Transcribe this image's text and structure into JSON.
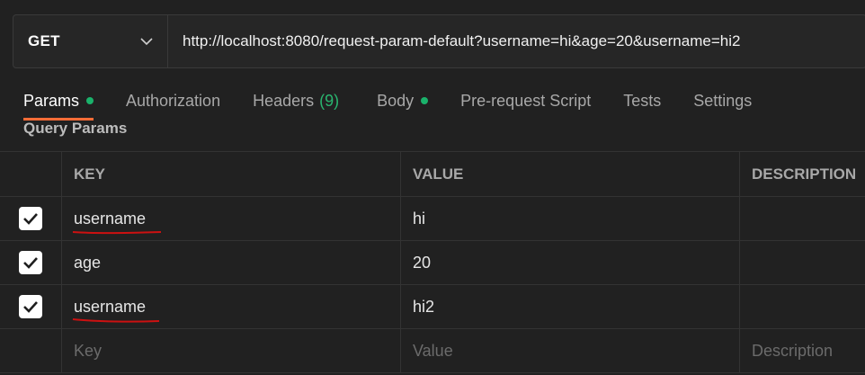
{
  "request": {
    "method": "GET",
    "url": "http://localhost:8080/request-param-default?username=hi&age=20&username=hi2"
  },
  "tabs": [
    {
      "label": "Params",
      "active": true,
      "dot": true
    },
    {
      "label": "Authorization"
    },
    {
      "label": "Headers",
      "count": "(9)"
    },
    {
      "label": "Body",
      "dot": true
    },
    {
      "label": "Pre-request Script"
    },
    {
      "label": "Tests"
    },
    {
      "label": "Settings"
    }
  ],
  "section_title": "Query Params",
  "table": {
    "headers": {
      "key": "KEY",
      "value": "VALUE",
      "description": "DESCRIPTION"
    },
    "rows": [
      {
        "checked": true,
        "key": "username",
        "value": "hi",
        "description": ""
      },
      {
        "checked": true,
        "key": "age",
        "value": "20",
        "description": ""
      },
      {
        "checked": true,
        "key": "username",
        "value": "hi2",
        "description": ""
      }
    ],
    "placeholders": {
      "key": "Key",
      "value": "Value",
      "description": "Description"
    }
  },
  "colors": {
    "background": "#212121",
    "accent": "#ff6c37",
    "dot_green": "#1ab26b",
    "annotation_red": "#cc1111"
  }
}
